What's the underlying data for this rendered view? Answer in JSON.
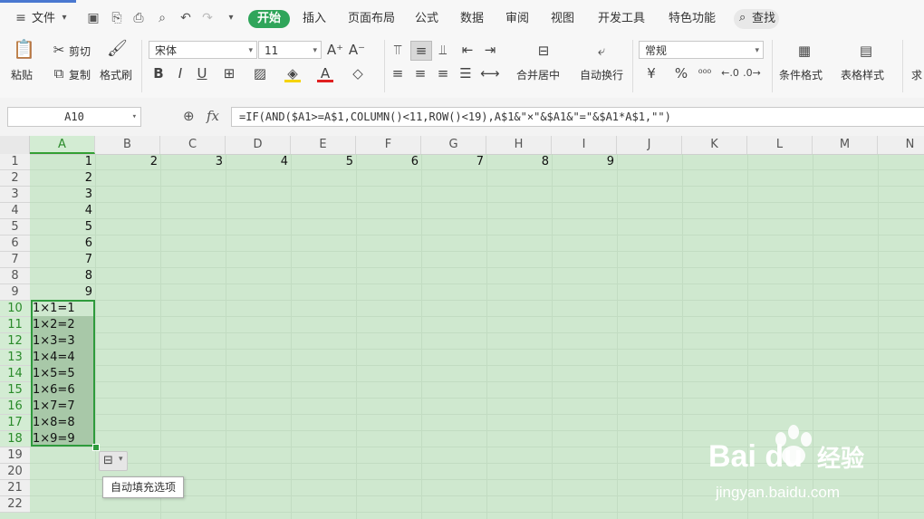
{
  "quick": {
    "file_label": "文件"
  },
  "tabs": {
    "start": "开始",
    "insert": "插入",
    "layout": "页面布局",
    "formula": "公式",
    "data": "数据",
    "review": "审阅",
    "view": "视图",
    "dev": "开发工具",
    "special": "特色功能",
    "search": "查找"
  },
  "ribbon": {
    "paste": "粘贴",
    "cut": "剪切",
    "copy": "复制",
    "format_painter": "格式刷",
    "font_name": "宋体",
    "font_size": "11",
    "merge_center": "合并居中",
    "wrap_text": "自动换行",
    "number_format": "常规",
    "currency_symbol": "¥",
    "percent_symbol": "%",
    "cond_format": "条件格式",
    "table_style": "表格样式",
    "sum_cut": "求"
  },
  "formula_bar": {
    "cell_ref": "A10",
    "fx": "fx",
    "formula": "=IF(AND($A1>=A$1,COLUMN()<11,ROW()<19),A$1&\"×\"&$A1&\"=\"&$A1*A$1,\"\")"
  },
  "columns": [
    "A",
    "B",
    "C",
    "D",
    "E",
    "F",
    "G",
    "H",
    "I",
    "J",
    "K",
    "L",
    "M",
    "N"
  ],
  "rows": [
    "1",
    "2",
    "3",
    "4",
    "5",
    "6",
    "7",
    "8",
    "9",
    "10",
    "11",
    "12",
    "13",
    "14",
    "15",
    "16",
    "17",
    "18",
    "19",
    "20",
    "21",
    "22"
  ],
  "row1_values": [
    "1",
    "2",
    "3",
    "4",
    "5",
    "6",
    "7",
    "8",
    "9"
  ],
  "colA_values": [
    "2",
    "3",
    "4",
    "5",
    "6",
    "7",
    "8",
    "9"
  ],
  "products": [
    "1×1=1",
    "1×2=2",
    "1×3=3",
    "1×4=4",
    "1×5=5",
    "1×6=6",
    "1×7=7",
    "1×8=8",
    "1×9=9"
  ],
  "tooltip": "自动填充选项",
  "watermark": {
    "brand": "Bai du",
    "cn": "经验",
    "url": "jingyan.baidu.com"
  },
  "colors": {
    "accent": "#2fa55a",
    "sheet_bg": "#cfe8cf",
    "selection": "#2e9b3c"
  }
}
